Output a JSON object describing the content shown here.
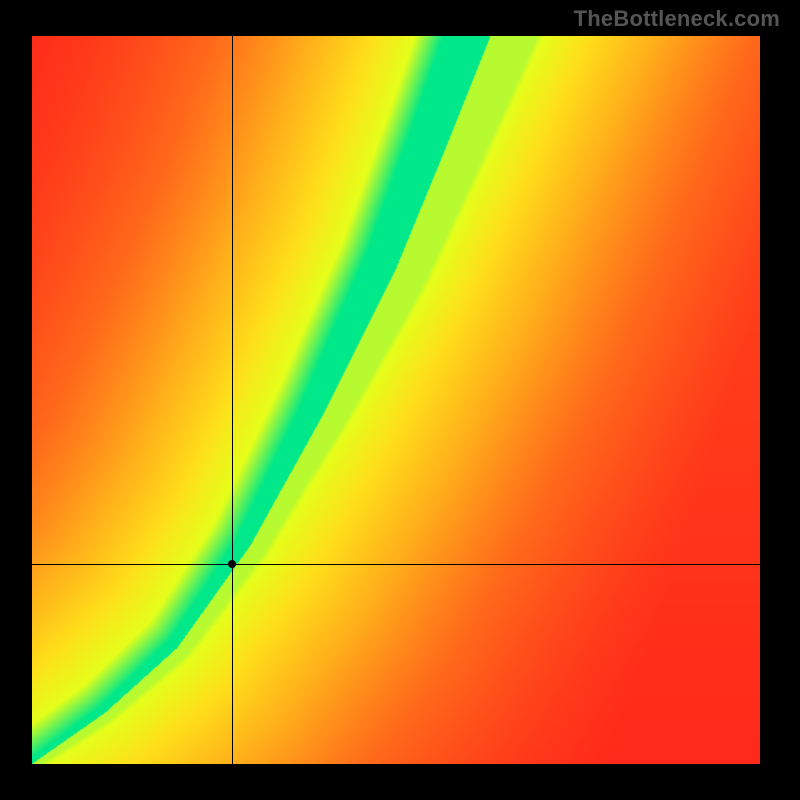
{
  "watermark": "TheBottleneck.com",
  "chart_data": {
    "type": "heatmap",
    "title": "",
    "xlabel": "",
    "ylabel": "",
    "xrange": [
      0,
      1
    ],
    "yrange": [
      0,
      1
    ],
    "crosshair": {
      "x": 0.275,
      "y": 0.275
    },
    "optimal_curve_description": "Diagonal optimum band from lower-left to upper-right, concave-up (steeper than y=x toward the top), where fit is best (green). Deviation toward lower-right or upper-left degrades toward red.",
    "colorscale": [
      {
        "t": 0.0,
        "color": "#ff2a1a"
      },
      {
        "t": 0.3,
        "color": "#ff6a1a"
      },
      {
        "t": 0.55,
        "color": "#ffb01a"
      },
      {
        "t": 0.75,
        "color": "#ffe01a"
      },
      {
        "t": 0.9,
        "color": "#e6ff1a"
      },
      {
        "t": 1.0,
        "color": "#00e88a"
      }
    ],
    "optimal_curve_samples": [
      {
        "x": 0.0,
        "y": 0.0
      },
      {
        "x": 0.1,
        "y": 0.07
      },
      {
        "x": 0.2,
        "y": 0.16
      },
      {
        "x": 0.3,
        "y": 0.3
      },
      {
        "x": 0.4,
        "y": 0.48
      },
      {
        "x": 0.5,
        "y": 0.68
      },
      {
        "x": 0.57,
        "y": 0.85
      },
      {
        "x": 0.63,
        "y": 1.0
      }
    ],
    "band_halfwidth_at": [
      {
        "x": 0.0,
        "w": 0.006
      },
      {
        "x": 0.3,
        "w": 0.02
      },
      {
        "x": 0.6,
        "w": 0.04
      },
      {
        "x": 1.0,
        "w": 0.06
      }
    ]
  }
}
